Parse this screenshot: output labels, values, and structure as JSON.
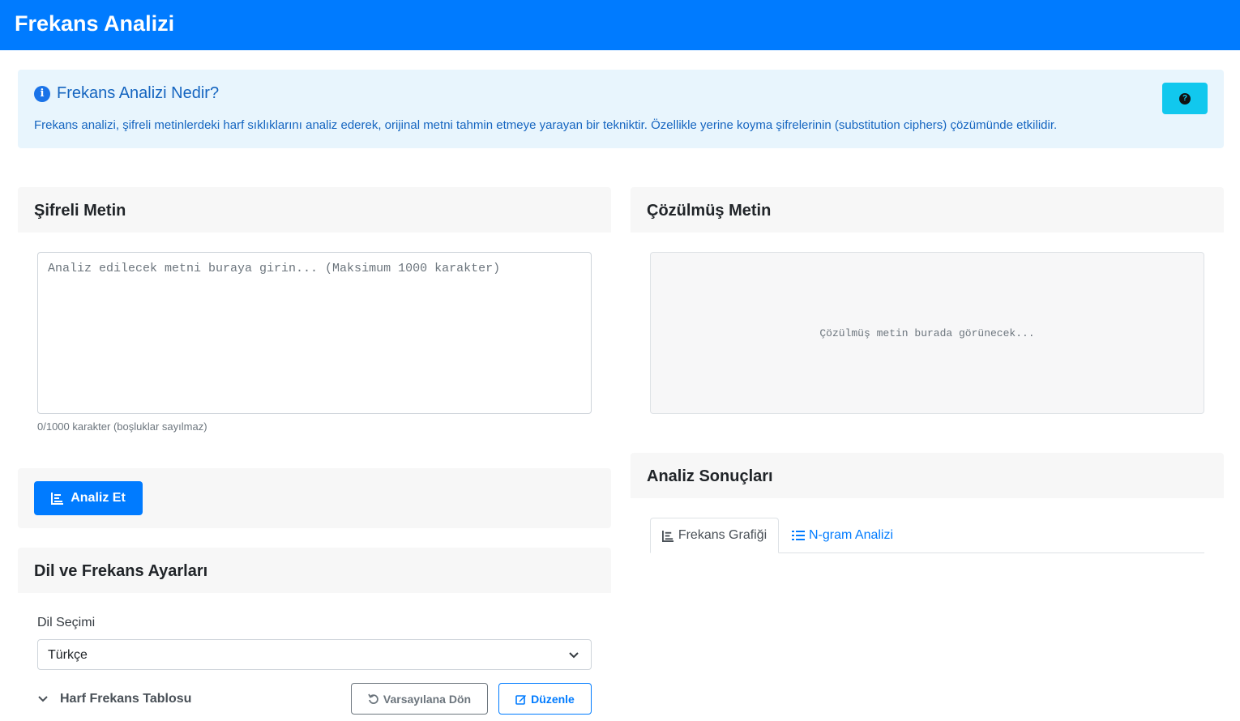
{
  "navbar": {
    "title": "Frekans Analizi"
  },
  "info": {
    "title": "Frekans Analizi Nedir?",
    "description": "Frekans analizi, şifreli metinlerdeki harf sıklıklarını analiz ederek, orijinal metni tahmin etmeye yarayan bir tekniktir. Özellikle yerine koyma şifrelerinin (substitution ciphers) çözümünde etkilidir.",
    "icon": "info-circle-icon",
    "help_icon": "question-circle-icon"
  },
  "cipher": {
    "header": "Şifreli Metin",
    "placeholder": "Analiz edilecek metni buraya girin... (Maksimum 1000 karakter)",
    "value": "",
    "char_count": "0/1000 karakter (boşluklar sayılmaz)"
  },
  "actions": {
    "analyze_label": "Analiz Et",
    "analyze_icon": "bar-chart-icon"
  },
  "solved": {
    "header": "Çözülmüş Metin",
    "placeholder": "Çözülmüş metin burada görünecek..."
  },
  "settings": {
    "header": "Dil ve Frekans Ayarları",
    "language_label": "Dil Seçimi",
    "language_value": "Türkçe",
    "freq_table_label": "Harf Frekans Tablosu",
    "reset_label": "Varsayılana Dön",
    "edit_label": "Düzenle"
  },
  "results": {
    "header": "Analiz Sonuçları",
    "tabs": [
      {
        "label": "Frekans Grafiği",
        "icon": "bar-chart-icon",
        "active": true
      },
      {
        "label": "N-gram Analizi",
        "icon": "list-icon",
        "active": false
      }
    ]
  },
  "colors": {
    "primary": "#007bff",
    "info_bg": "#e8f5fd",
    "info_text": "#1565c0",
    "help_btn": "#11c8ee"
  }
}
